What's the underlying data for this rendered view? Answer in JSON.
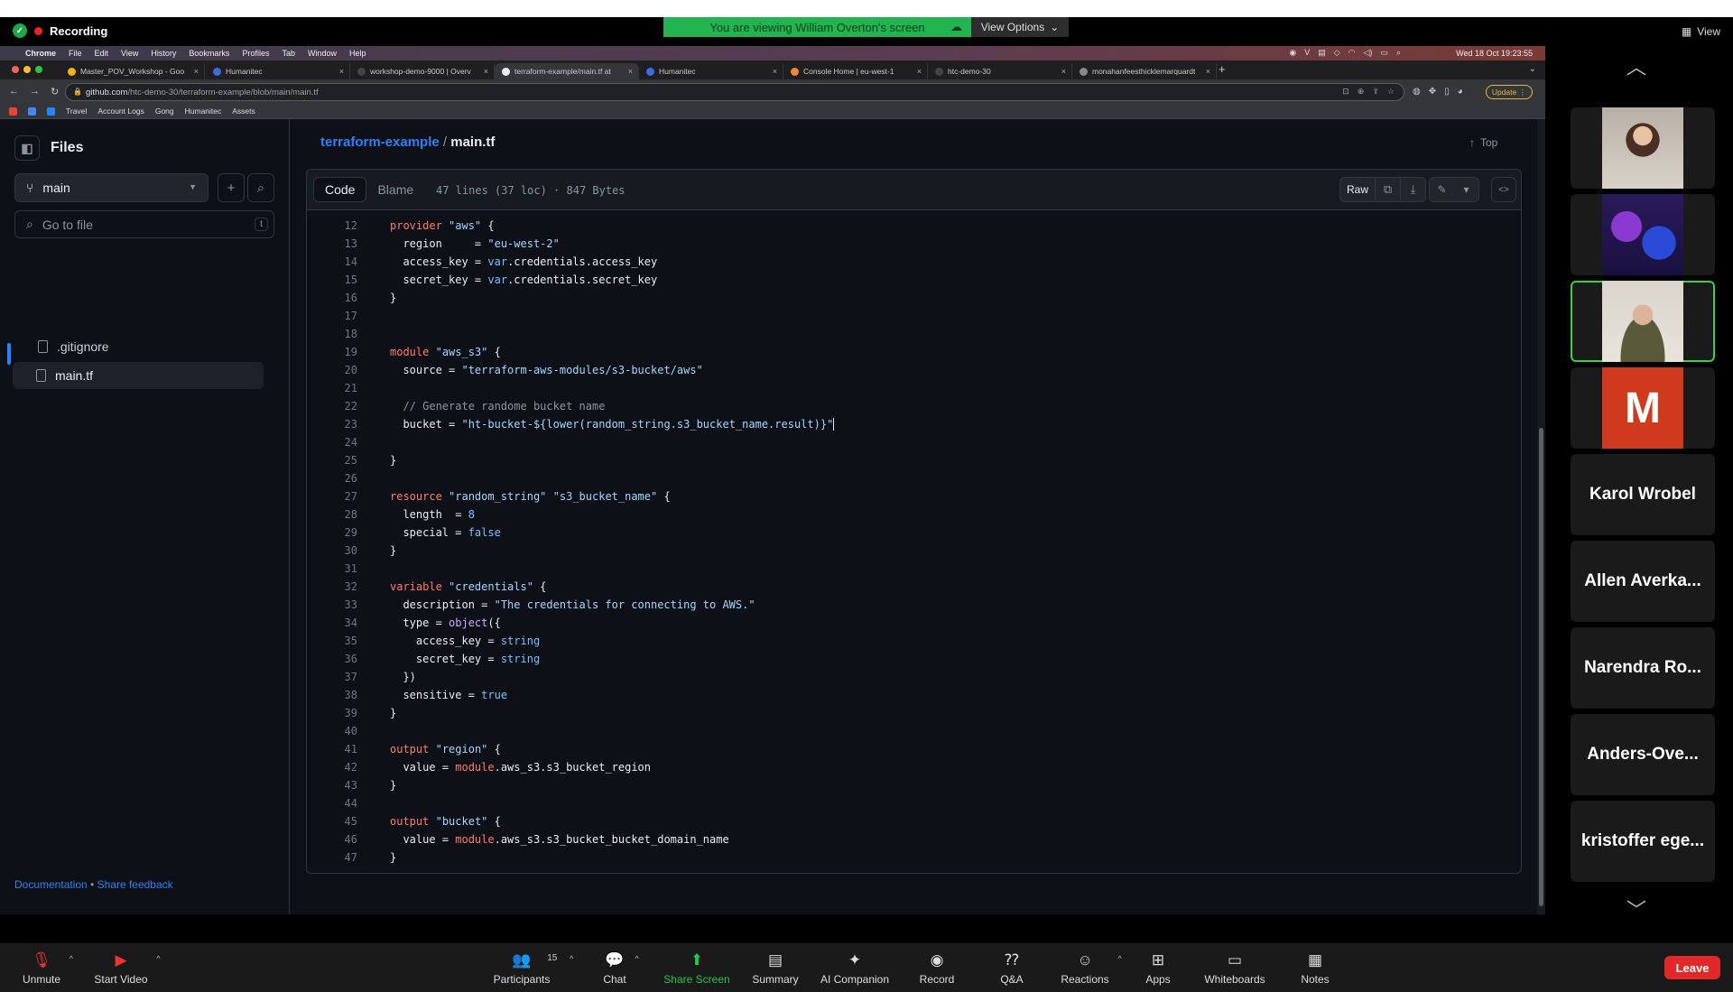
{
  "zoom": {
    "recording_label": "Recording",
    "viewing_banner": "You are viewing William Overton's screen",
    "view_options": "View Options",
    "view_label": "View",
    "participants_count": "15",
    "toolbar": [
      {
        "key": "unmute",
        "label": "Unmute",
        "icon": "mic-muted-icon"
      },
      {
        "key": "start-video",
        "label": "Start Video",
        "icon": "video-off-icon"
      },
      {
        "key": "participants",
        "label": "Participants",
        "icon": "participants-icon"
      },
      {
        "key": "chat",
        "label": "Chat",
        "icon": "chat-icon"
      },
      {
        "key": "share-screen",
        "label": "Share Screen",
        "icon": "share-screen-icon"
      },
      {
        "key": "summary",
        "label": "Summary",
        "icon": "summary-icon"
      },
      {
        "key": "ai-companion",
        "label": "AI Companion",
        "icon": "sparkle-icon"
      },
      {
        "key": "record",
        "label": "Record",
        "icon": "record-icon"
      },
      {
        "key": "qa",
        "label": "Q&A",
        "icon": "qa-icon"
      },
      {
        "key": "reactions",
        "label": "Reactions",
        "icon": "reactions-icon"
      },
      {
        "key": "apps",
        "label": "Apps",
        "icon": "apps-icon"
      },
      {
        "key": "whiteboards",
        "label": "Whiteboards",
        "icon": "whiteboard-icon"
      },
      {
        "key": "notes",
        "label": "Notes",
        "icon": "notes-icon"
      }
    ],
    "leave_label": "Leave",
    "gallery": [
      {
        "type": "video",
        "name": ""
      },
      {
        "type": "video",
        "name": ""
      },
      {
        "type": "video",
        "name": "",
        "active": true
      },
      {
        "type": "avatar",
        "initial": "M"
      },
      {
        "type": "name",
        "name": "Karol Wrobel"
      },
      {
        "type": "name",
        "name": "Allen Averka..."
      },
      {
        "type": "name",
        "name": "Narendra Ro..."
      },
      {
        "type": "name",
        "name": "Anders-Ove..."
      },
      {
        "type": "name",
        "name": "kristoffer ege..."
      }
    ]
  },
  "mac": {
    "menu": [
      "Chrome",
      "File",
      "Edit",
      "View",
      "History",
      "Bookmarks",
      "Profiles",
      "Tab",
      "Window",
      "Help"
    ],
    "clock": "Wed 18 Oct  19:23:55"
  },
  "browser": {
    "tabs": [
      {
        "title": "Master_POV_Workshop - Goo",
        "color": "#f4b400",
        "active": false
      },
      {
        "title": "Humanitec",
        "color": "#3f6ae0",
        "active": false
      },
      {
        "title": "workshop-demo-9000 | Overv",
        "color": "#444",
        "active": false
      },
      {
        "title": "terraform-example/main.tf at",
        "color": "#e6edf3",
        "active": true
      },
      {
        "title": "Humanitec",
        "color": "#3f6ae0",
        "active": false
      },
      {
        "title": "Console Home | eu-west-1",
        "color": "#f58536",
        "active": false
      },
      {
        "title": "htc-demo-30",
        "color": "#444",
        "active": false
      },
      {
        "title": "monahanfeesthicklemarquardt",
        "color": "#888",
        "active": false
      }
    ],
    "url_host": "github.com",
    "url_path": "/htc-demo-30/terraform-example/blob/main/main.tf",
    "update_label": "Update",
    "bookmarks": [
      "Travel",
      "Account Logs",
      "Gong",
      "Humanitec",
      "Assets"
    ]
  },
  "github": {
    "sidebar": {
      "title": "Files",
      "branch": "main",
      "search_placeholder": "Go to file",
      "search_key": "t",
      "files": [
        {
          "name": ".gitignore",
          "selected": false
        },
        {
          "name": "main.tf",
          "selected": true
        }
      ],
      "footer_docs": "Documentation",
      "footer_sep": " • ",
      "footer_feedback": "Share feedback"
    },
    "breadcrumb": {
      "repo": "terraform-example",
      "sep": " / ",
      "file": "main.tf"
    },
    "top_label": "Top",
    "tabs": {
      "code": "Code",
      "blame": "Blame"
    },
    "file_info": "47 lines (37 loc) · 847 Bytes",
    "raw_label": "Raw",
    "code_lines": [
      {
        "n": "12",
        "t": "provider \"aws\" {"
      },
      {
        "n": "13",
        "t": "  region     = \"eu-west-2\""
      },
      {
        "n": "14",
        "t": "  access_key = var.credentials.access_key"
      },
      {
        "n": "15",
        "t": "  secret_key = var.credentials.secret_key"
      },
      {
        "n": "16",
        "t": "}"
      },
      {
        "n": "17",
        "t": ""
      },
      {
        "n": "18",
        "t": ""
      },
      {
        "n": "19",
        "t": "module \"aws_s3\" {"
      },
      {
        "n": "20",
        "t": "  source = \"terraform-aws-modules/s3-bucket/aws\""
      },
      {
        "n": "21",
        "t": ""
      },
      {
        "n": "22",
        "t": "  // Generate randome bucket name"
      },
      {
        "n": "23",
        "t": "  bucket = \"ht-bucket-${lower(random_string.s3_bucket_name.result)}\""
      },
      {
        "n": "24",
        "t": ""
      },
      {
        "n": "25",
        "t": "}"
      },
      {
        "n": "26",
        "t": ""
      },
      {
        "n": "27",
        "t": "resource \"random_string\" \"s3_bucket_name\" {"
      },
      {
        "n": "28",
        "t": "  length  = 8"
      },
      {
        "n": "29",
        "t": "  special = false"
      },
      {
        "n": "30",
        "t": "}"
      },
      {
        "n": "31",
        "t": ""
      },
      {
        "n": "32",
        "t": "variable \"credentials\" {"
      },
      {
        "n": "33",
        "t": "  description = \"The credentials for connecting to AWS.\""
      },
      {
        "n": "34",
        "t": "  type = object({"
      },
      {
        "n": "35",
        "t": "    access_key = string"
      },
      {
        "n": "36",
        "t": "    secret_key = string"
      },
      {
        "n": "37",
        "t": "  })"
      },
      {
        "n": "38",
        "t": "  sensitive = true"
      },
      {
        "n": "39",
        "t": "}"
      },
      {
        "n": "40",
        "t": ""
      },
      {
        "n": "41",
        "t": "output \"region\" {"
      },
      {
        "n": "42",
        "t": "  value = module.aws_s3.s3_bucket_region"
      },
      {
        "n": "43",
        "t": "}"
      },
      {
        "n": "44",
        "t": ""
      },
      {
        "n": "45",
        "t": "output \"bucket\" {"
      },
      {
        "n": "46",
        "t": "  value = module.aws_s3.s3_bucket_bucket_domain_name"
      },
      {
        "n": "47",
        "t": "}"
      }
    ]
  },
  "colors": {
    "zoom_green": "#22b450",
    "leave_red": "#e02828",
    "link_blue": "#2f81f7",
    "github_bg": "#0d1117"
  }
}
